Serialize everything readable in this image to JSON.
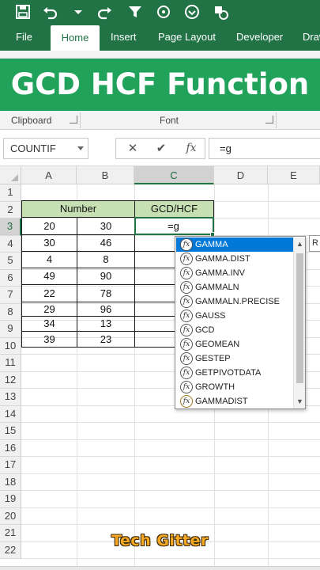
{
  "colors": {
    "ribbon": "#217346",
    "banner": "#20a25a",
    "header_fill": "#c6e0b4",
    "selection": "#0078d7",
    "watermark": "#f7a823"
  },
  "titlebar": {
    "icons": [
      "save-icon",
      "undo-icon",
      "dropdown-icon",
      "redo-icon",
      "filter-icon",
      "circle-icon",
      "down-circle-icon",
      "shape-icon"
    ]
  },
  "ribbon": {
    "tabs": [
      "File",
      "Home",
      "Insert",
      "Page Layout",
      "Developer",
      "Draw"
    ],
    "active_tab": "Home",
    "groups": [
      "Clipboard",
      "Font"
    ]
  },
  "banner": {
    "text": "GCD HCF Function"
  },
  "formula_bar": {
    "name_box": "COUNTIF",
    "cancel_icon": "✕",
    "enter_icon": "✔",
    "fx_label": "fx",
    "formula": "=g"
  },
  "columns": [
    "A",
    "B",
    "C",
    "D",
    "E"
  ],
  "selected_column": "C",
  "rows": [
    "1",
    "2",
    "3",
    "4",
    "5",
    "6",
    "7",
    "8",
    "9",
    "10",
    "11",
    "12",
    "13",
    "14",
    "15",
    "16",
    "17",
    "18",
    "19",
    "20",
    "21",
    "22"
  ],
  "selected_row": "3",
  "table": {
    "number_header": "Number",
    "gcd_header": "GCD/HCF",
    "rows": [
      {
        "a": "20",
        "b": "30"
      },
      {
        "a": "30",
        "b": "46"
      },
      {
        "a": "4",
        "b": "8"
      },
      {
        "a": "49",
        "b": "90"
      },
      {
        "a": "22",
        "b": "78"
      },
      {
        "a": "29",
        "b": "96"
      },
      {
        "a": "34",
        "b": "13"
      },
      {
        "a": "39",
        "b": "23"
      }
    ],
    "active_cell_value": "=g"
  },
  "autocomplete": {
    "items": [
      "GAMMA",
      "GAMMA.DIST",
      "GAMMA.INV",
      "GAMMALN",
      "GAMMALN.PRECISE",
      "GAUSS",
      "GCD",
      "GEOMEAN",
      "GESTEP",
      "GETPIVOTDATA",
      "GROWTH",
      "GAMMADIST"
    ],
    "selected": "GAMMA",
    "tooltip_fragment": "R"
  },
  "watermark": "Tech Gitter"
}
